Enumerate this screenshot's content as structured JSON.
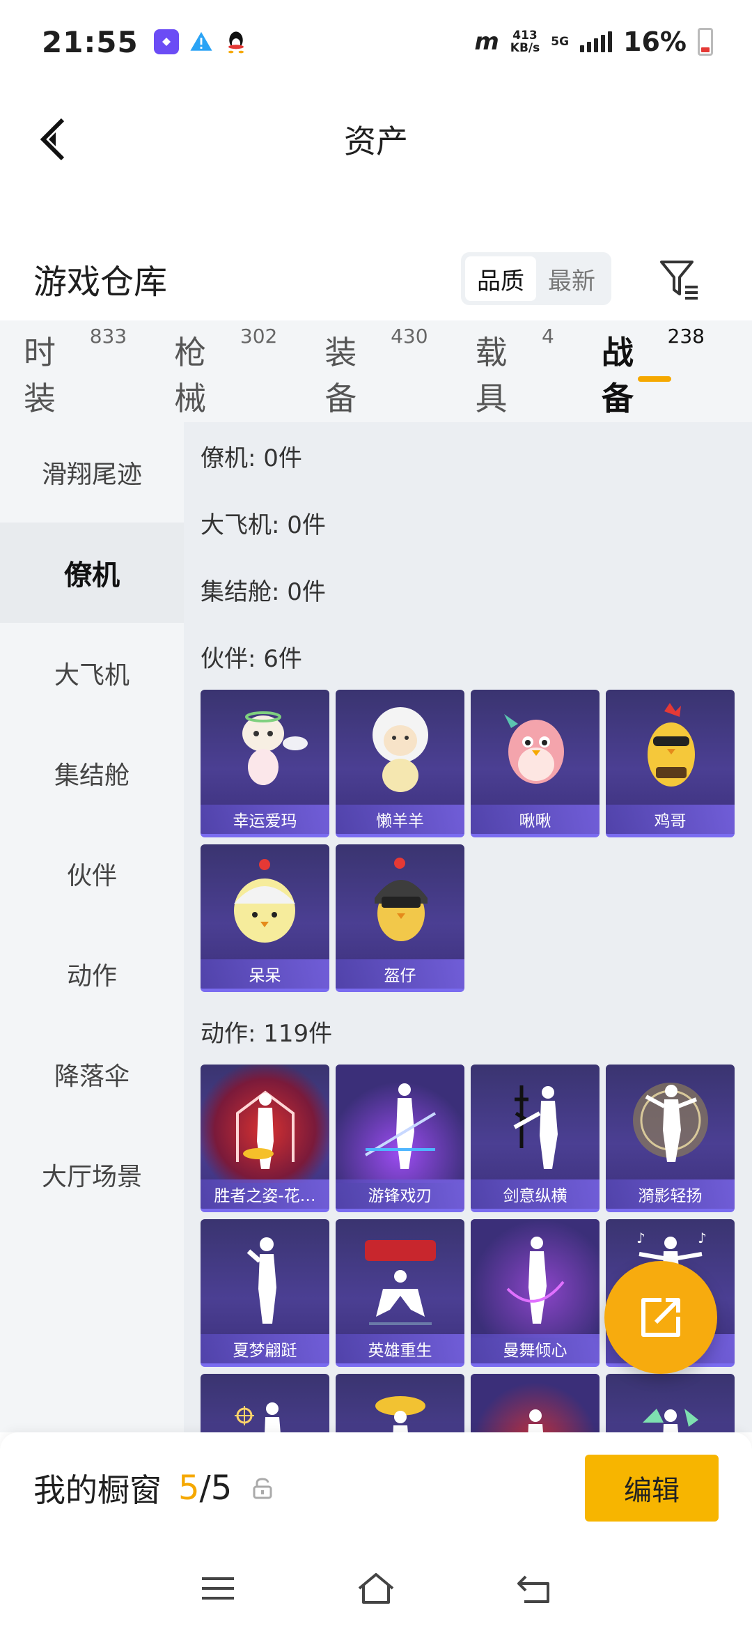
{
  "status_bar": {
    "time": "21:55",
    "net_speed_value": "413",
    "net_speed_unit": "KB/s",
    "network": "5G",
    "battery": "16%"
  },
  "header": {
    "title": "资产"
  },
  "warehouse": {
    "title": "游戏仓库",
    "sort_options": [
      "品质",
      "最新"
    ],
    "sort_selected": "品质"
  },
  "tabs": [
    {
      "label": "时装",
      "count": "833"
    },
    {
      "label": "枪械",
      "count": "302"
    },
    {
      "label": "装备",
      "count": "430"
    },
    {
      "label": "载具",
      "count": "4"
    },
    {
      "label": "战备",
      "count": "238"
    }
  ],
  "active_tab": "战备",
  "side_menu": [
    "滑翔尾迹",
    "僚机",
    "大飞机",
    "集结舱",
    "伙伴",
    "动作",
    "降落伞",
    "大厅场景"
  ],
  "side_selected": "僚机",
  "sections": {
    "wingman": "僚机: 0件",
    "big_plane": "大飞机: 0件",
    "assembly": "集结舱: 0件",
    "partner": "伙伴: 6件",
    "emote": "动作: 119件"
  },
  "partners": [
    {
      "name": "幸运爱玛",
      "icon": "angel-cat-icon"
    },
    {
      "name": "懒羊羊",
      "icon": "sheep-icon"
    },
    {
      "name": "啾啾",
      "icon": "pink-bird-icon"
    },
    {
      "name": "鸡哥",
      "icon": "rooster-sunglasses-icon"
    },
    {
      "name": "呆呆",
      "icon": "chick-icon"
    },
    {
      "name": "盔仔",
      "icon": "helmet-chick-icon"
    }
  ],
  "emotes": [
    {
      "name": "胜者之姿-花…",
      "icon": "victory-pose-icon"
    },
    {
      "name": "游锋戏刃",
      "icon": "blade-dance-icon"
    },
    {
      "name": "剑意纵横",
      "icon": "sword-pose-icon"
    },
    {
      "name": "漪影轻扬",
      "icon": "ripple-dance-icon"
    },
    {
      "name": "夏梦翩跹",
      "icon": "summer-dance-icon"
    },
    {
      "name": "英雄重生",
      "icon": "hero-reborn-icon"
    },
    {
      "name": "曼舞倾心",
      "icon": "graceful-dance-icon"
    },
    {
      "name": "",
      "icon": "music-dance-icon"
    },
    {
      "name": "",
      "icon": "aim-pose-icon"
    },
    {
      "name": "",
      "icon": "golden-pose-icon"
    },
    {
      "name": "",
      "icon": "fire-pose-icon"
    },
    {
      "name": "",
      "icon": "splash-pose-icon"
    }
  ],
  "showcase": {
    "label": "我的橱窗",
    "current": "5",
    "total": "/5",
    "edit_label": "编辑"
  },
  "colors": {
    "accent": "#f5a800",
    "card_bg": "#3f3682",
    "card_border": "#7a6cf0"
  }
}
